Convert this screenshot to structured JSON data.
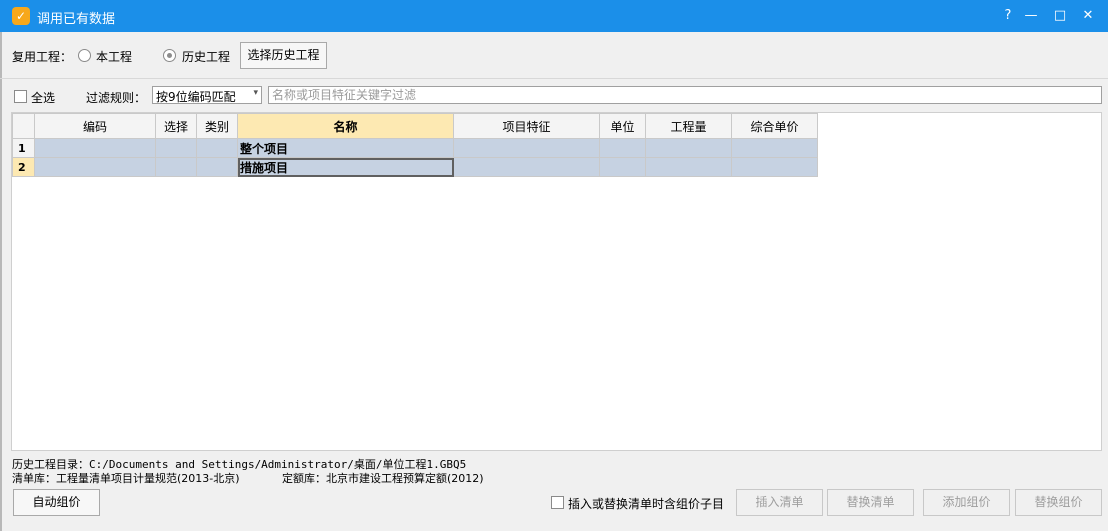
{
  "window": {
    "title": "调用已有数据",
    "app_icon": "app-logo-icon",
    "help_glyph": "?",
    "minimize_glyph": "—",
    "maximize_glyph": "□",
    "close_glyph": "✕"
  },
  "project": {
    "label": "复用工程：",
    "option_current": "本工程",
    "option_history": "历史工程",
    "selected": "历史工程",
    "select_button": "选择历史工程"
  },
  "filter": {
    "select_all": "全选",
    "rule_label": "过滤规则：",
    "rule_value": "按9位编码匹配",
    "rule_arrow": "▾",
    "placeholder": "名称或项目特征关键字过滤"
  },
  "grid": {
    "columns": [
      "编码",
      "选择",
      "类别",
      "名称",
      "项目特征",
      "单位",
      "工程量",
      "综合单价"
    ],
    "rows": [
      {
        "num": "1",
        "name": "整个项目"
      },
      {
        "num": "2",
        "name": "措施项目"
      }
    ]
  },
  "info": {
    "history_dir": "历史工程目录：C:/Documents and Settings/Administrator/桌面/单位工程1.GBQ5",
    "bill_lib": "清单库：工程量清单项目计量规范(2013-北京)",
    "quota_lib": "定额库：北京市建设工程预算定额(2012)"
  },
  "footer": {
    "auto_price": "自动组价",
    "include_children": "插入或替换清单时含组价子目",
    "insert_bill": "插入清单",
    "replace_bill": "替换清单",
    "add_price": "添加组价",
    "replace_price": "替换组价"
  },
  "colors": {
    "titlebar": "#1b8fe9",
    "header_highlight": "#fde9b2",
    "row_fill": "#c6d2e2"
  }
}
